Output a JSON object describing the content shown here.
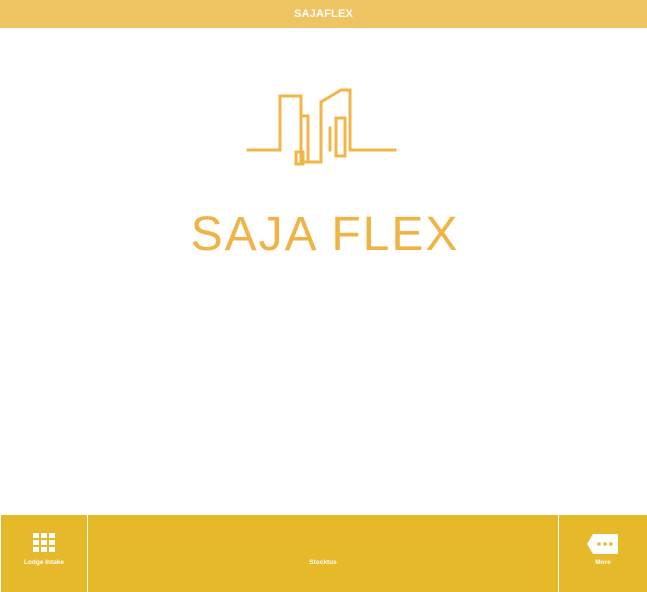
{
  "app": {
    "title": "SAJAFLEX"
  },
  "logo": {
    "text": "SAJA FLEX",
    "color": "#f0b346",
    "icon": "city-buildings-logo"
  },
  "colors": {
    "header": "#efc463",
    "tabbar": "#e5b929",
    "text_light": "#ffffff"
  },
  "tabbar": {
    "tabs": [
      {
        "label": "Lodge Intake",
        "icon": "grid-icon"
      },
      {
        "label": "Stocktus",
        "icon": ""
      },
      {
        "label": "More",
        "icon": "more-icon"
      }
    ]
  }
}
